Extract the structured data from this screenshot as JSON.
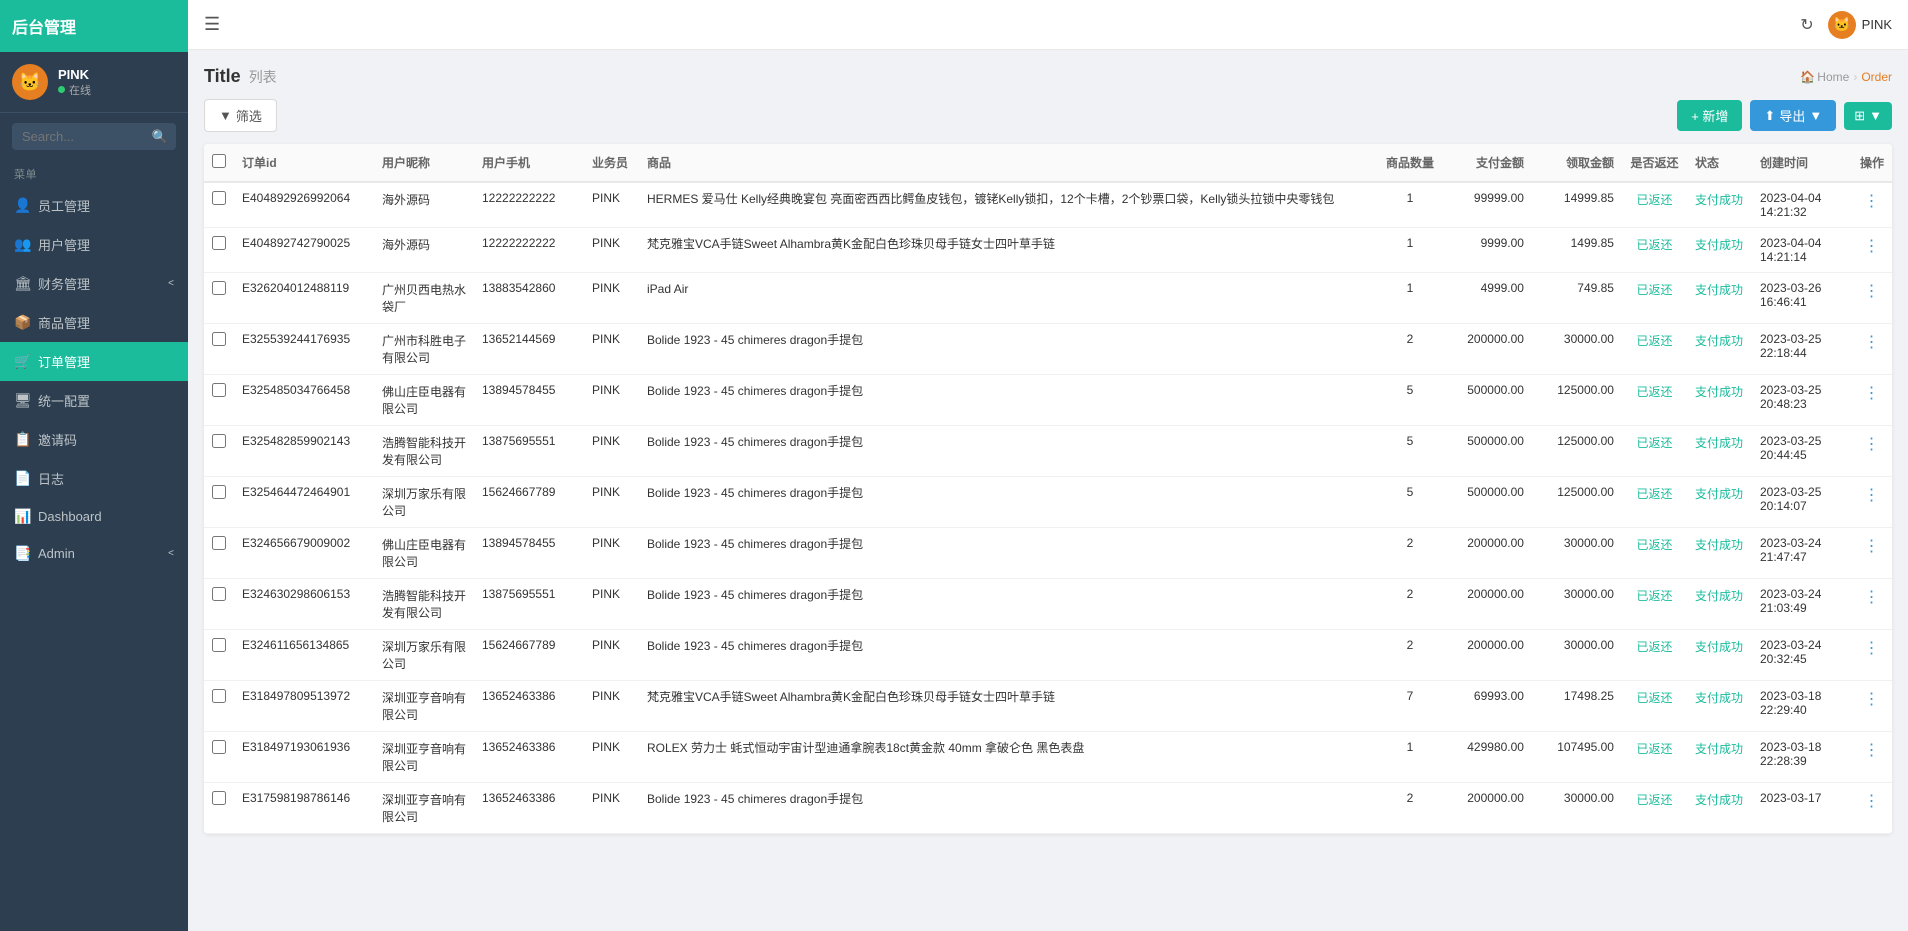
{
  "app": {
    "title": "后台管理",
    "topbar": {
      "refresh_icon": "↻",
      "user_label": "PINK"
    }
  },
  "sidebar": {
    "logo": "后台管理",
    "user": {
      "name": "PINK",
      "status": "在线",
      "avatar_emoji": "🐱"
    },
    "search_placeholder": "Search...",
    "section_label": "菜单",
    "nav_items": [
      {
        "id": "staff",
        "label": "员工管理",
        "icon": "👤",
        "active": false
      },
      {
        "id": "user",
        "label": "用户管理",
        "icon": "👥",
        "active": false
      },
      {
        "id": "finance",
        "label": "财务管理",
        "icon": "🏛",
        "active": false,
        "has_arrow": true
      },
      {
        "id": "goods",
        "label": "商品管理",
        "icon": "📦",
        "active": false
      },
      {
        "id": "order",
        "label": "订单管理",
        "icon": "🛒",
        "active": true
      },
      {
        "id": "config",
        "label": "统一配置",
        "icon": "🖥",
        "active": false
      },
      {
        "id": "invite",
        "label": "邀请码",
        "icon": "📋",
        "active": false
      },
      {
        "id": "log",
        "label": "日志",
        "icon": "📄",
        "active": false
      },
      {
        "id": "dashboard",
        "label": "Dashboard",
        "icon": "📊",
        "active": false
      },
      {
        "id": "admin",
        "label": "Admin",
        "icon": "📑",
        "active": false,
        "has_arrow": true
      }
    ]
  },
  "page": {
    "title": "Title",
    "subtitle": "列表",
    "breadcrumb": {
      "home": "Home",
      "current": "Order"
    }
  },
  "toolbar": {
    "filter_label": "筛选",
    "new_label": "+ 新增",
    "export_label": "导出",
    "cols_label": "⊞"
  },
  "table": {
    "headers": [
      "",
      "订单id",
      "用户昵称",
      "用户手机",
      "业务员",
      "商品",
      "商品数量",
      "支付金额",
      "领取金额",
      "是否返还",
      "状态",
      "创建时间",
      "操作"
    ],
    "rows": [
      {
        "id": "E404892926992064",
        "user": "海外源码",
        "phone": "12222222222",
        "staff": "PINK",
        "goods": "HERMES 爱马仕 Kelly经典晚宴包 亮面密西西比鳄鱼皮钱包，镀铑Kelly锁扣，12个卡槽，2个钞票口袋，Kelly锁头拉锁中央零钱包",
        "count": "1",
        "pay": "99999.00",
        "receive": "14999.85",
        "returned": "已返还",
        "status": "支付成功",
        "time": "2023-04-04 14:21:32"
      },
      {
        "id": "E404892742790025",
        "user": "海外源码",
        "phone": "12222222222",
        "staff": "PINK",
        "goods": "梵克雅宝VCA手链Sweet Alhambra黄K金配白色珍珠贝母手链女士四叶草手链",
        "count": "1",
        "pay": "9999.00",
        "receive": "1499.85",
        "returned": "已返还",
        "status": "支付成功",
        "time": "2023-04-04 14:21:14"
      },
      {
        "id": "E326204012488119",
        "user": "广州贝西电热水袋厂",
        "phone": "13883542860",
        "staff": "PINK",
        "goods": "iPad Air",
        "count": "1",
        "pay": "4999.00",
        "receive": "749.85",
        "returned": "已返还",
        "status": "支付成功",
        "time": "2023-03-26 16:46:41"
      },
      {
        "id": "E325539244176935",
        "user": "广州市科胜电子有限公司",
        "phone": "13652144569",
        "staff": "PINK",
        "goods": "Bolide 1923 - 45 chimeres dragon手提包",
        "count": "2",
        "pay": "200000.00",
        "receive": "30000.00",
        "returned": "已返还",
        "status": "支付成功",
        "time": "2023-03-25 22:18:44"
      },
      {
        "id": "E325485034766458",
        "user": "佛山庄臣电器有限公司",
        "phone": "13894578455",
        "staff": "PINK",
        "goods": "Bolide 1923 - 45 chimeres dragon手提包",
        "count": "5",
        "pay": "500000.00",
        "receive": "125000.00",
        "returned": "已返还",
        "status": "支付成功",
        "time": "2023-03-25 20:48:23"
      },
      {
        "id": "E325482859902143",
        "user": "浩腾智能科技开发有限公司",
        "phone": "13875695551",
        "staff": "PINK",
        "goods": "Bolide 1923 - 45 chimeres dragon手提包",
        "count": "5",
        "pay": "500000.00",
        "receive": "125000.00",
        "returned": "已返还",
        "status": "支付成功",
        "time": "2023-03-25 20:44:45"
      },
      {
        "id": "E325464472464901",
        "user": "深圳万家乐有限公司",
        "phone": "15624667789",
        "staff": "PINK",
        "goods": "Bolide 1923 - 45 chimeres dragon手提包",
        "count": "5",
        "pay": "500000.00",
        "receive": "125000.00",
        "returned": "已返还",
        "status": "支付成功",
        "time": "2023-03-25 20:14:07"
      },
      {
        "id": "E324656679009002",
        "user": "佛山庄臣电器有限公司",
        "phone": "13894578455",
        "staff": "PINK",
        "goods": "Bolide 1923 - 45 chimeres dragon手提包",
        "count": "2",
        "pay": "200000.00",
        "receive": "30000.00",
        "returned": "已返还",
        "status": "支付成功",
        "time": "2023-03-24 21:47:47"
      },
      {
        "id": "E324630298606153",
        "user": "浩腾智能科技开发有限公司",
        "phone": "13875695551",
        "staff": "PINK",
        "goods": "Bolide 1923 - 45 chimeres dragon手提包",
        "count": "2",
        "pay": "200000.00",
        "receive": "30000.00",
        "returned": "已返还",
        "status": "支付成功",
        "time": "2023-03-24 21:03:49"
      },
      {
        "id": "E324611656134865",
        "user": "深圳万家乐有限公司",
        "phone": "15624667789",
        "staff": "PINK",
        "goods": "Bolide 1923 - 45 chimeres dragon手提包",
        "count": "2",
        "pay": "200000.00",
        "receive": "30000.00",
        "returned": "已返还",
        "status": "支付成功",
        "time": "2023-03-24 20:32:45"
      },
      {
        "id": "E318497809513972",
        "user": "深圳亚亨音响有限公司",
        "phone": "13652463386",
        "staff": "PINK",
        "goods": "梵克雅宝VCA手链Sweet Alhambra黄K金配白色珍珠贝母手链女士四叶草手链",
        "count": "7",
        "pay": "69993.00",
        "receive": "17498.25",
        "returned": "已返还",
        "status": "支付成功",
        "time": "2023-03-18 22:29:40"
      },
      {
        "id": "E318497193061936",
        "user": "深圳亚亨音响有限公司",
        "phone": "13652463386",
        "staff": "PINK",
        "goods": "ROLEX 劳力士 蚝式恒动宇宙计型迪通拿腕表18ct黄金款 40mm 拿破仑色 黑色表盘",
        "count": "1",
        "pay": "429980.00",
        "receive": "107495.00",
        "returned": "已返还",
        "status": "支付成功",
        "time": "2023-03-18 22:28:39"
      },
      {
        "id": "E317598198786146",
        "user": "深圳亚亨音响有限公司",
        "phone": "13652463386",
        "staff": "PINK",
        "goods": "Bolide 1923 - 45 chimeres dragon手提包",
        "count": "2",
        "pay": "200000.00",
        "receive": "30000.00",
        "returned": "已返还",
        "status": "支付成功",
        "time": "2023-03-17"
      }
    ]
  }
}
